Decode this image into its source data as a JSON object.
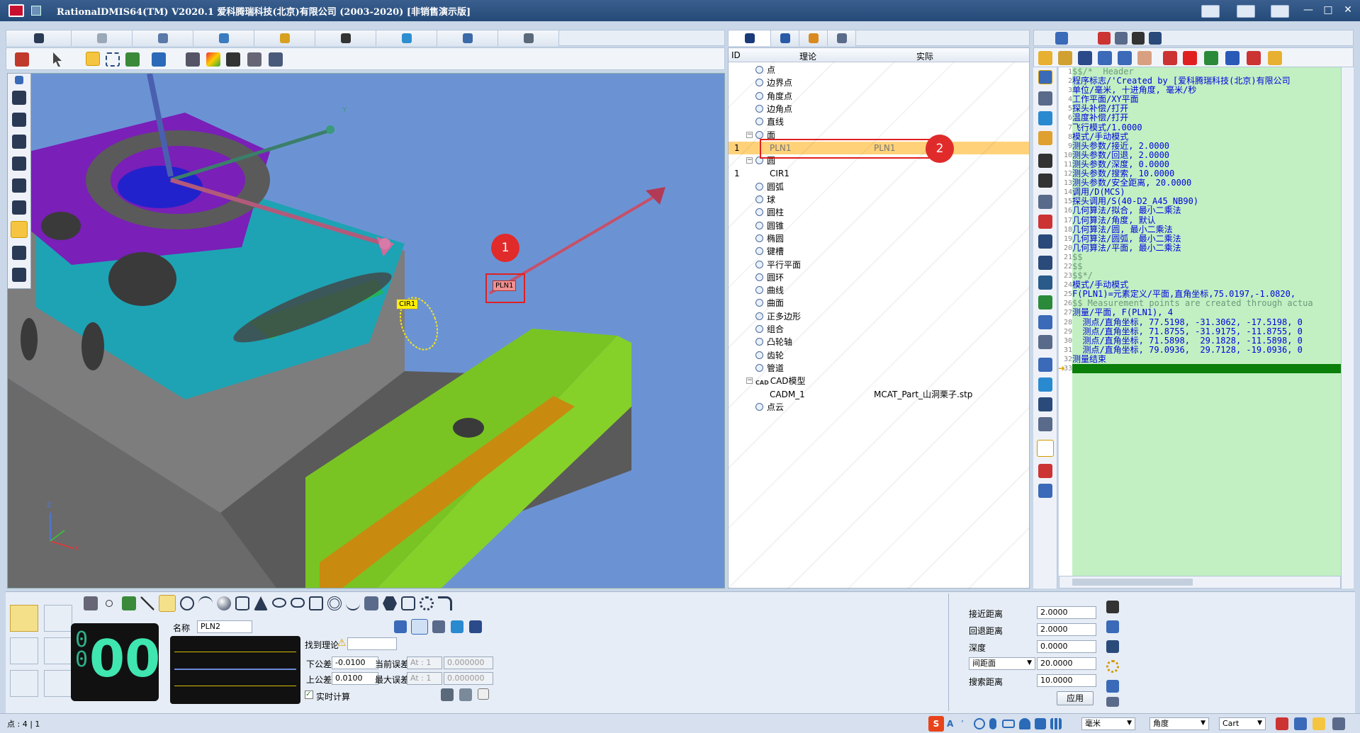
{
  "window": {
    "title": "RationalDMIS64(TM) V2020.1    爱科腾瑞科技(北京)有限公司 (2003-2020) [非销售演示版]"
  },
  "tree": {
    "columns": {
      "id": "ID",
      "theory": "理论",
      "actual": "实际"
    },
    "items": [
      {
        "label": "点"
      },
      {
        "label": "边界点"
      },
      {
        "label": "角度点"
      },
      {
        "label": "边角点"
      },
      {
        "label": "直线"
      },
      {
        "label": "面"
      },
      {
        "label": "PLN1",
        "id": "1",
        "actual": "PLN1"
      },
      {
        "label": "圆"
      },
      {
        "label": "CIR1",
        "id": "1"
      },
      {
        "label": "圆弧"
      },
      {
        "label": "球"
      },
      {
        "label": "圆柱"
      },
      {
        "label": "圆锥"
      },
      {
        "label": "椭圆"
      },
      {
        "label": "键槽"
      },
      {
        "label": "平行平面"
      },
      {
        "label": "圆环"
      },
      {
        "label": "曲线"
      },
      {
        "label": "曲面"
      },
      {
        "label": "正多边形"
      },
      {
        "label": "组合"
      },
      {
        "label": "凸轮轴"
      },
      {
        "label": "齿轮"
      },
      {
        "label": "管道"
      },
      {
        "label": "CAD模型",
        "prefix": "CAD"
      },
      {
        "label": "CADM_1",
        "actual": "MCAT_Part_山洞栗子.stp"
      },
      {
        "label": "点云"
      }
    ]
  },
  "viewport": {
    "labels": {
      "pln": "PLN1",
      "cir": "CIR1"
    },
    "markers": {
      "one": "1",
      "two": "2"
    },
    "axis": {
      "x": "X",
      "y": "Y",
      "z": "Z"
    }
  },
  "editor": {
    "lines": [
      {
        "n": "1",
        "t": "$$/*  Header",
        "c": "g"
      },
      {
        "n": "2",
        "t": "程序标志/'Created by [爱科腾瑞科技(北京)有限公司",
        "c": "b"
      },
      {
        "n": "3",
        "t": "单位/毫米, 十进角度, 毫米/秒",
        "c": "b"
      },
      {
        "n": "4",
        "t": "工作平面/XY平面",
        "c": "b"
      },
      {
        "n": "5",
        "t": "探头补偿/打开",
        "c": "b"
      },
      {
        "n": "6",
        "t": "温度补偿/打开",
        "c": "b"
      },
      {
        "n": "7",
        "t": "飞行模式/1.0000",
        "c": "b"
      },
      {
        "n": "8",
        "t": "模式/手动模式",
        "c": "b"
      },
      {
        "n": "9",
        "t": "测头参数/接近, 2.0000",
        "c": "b"
      },
      {
        "n": "10",
        "t": "测头参数/回退, 2.0000",
        "c": "b"
      },
      {
        "n": "11",
        "t": "测头参数/深度, 0.0000",
        "c": "b"
      },
      {
        "n": "12",
        "t": "测头参数/搜索, 10.0000",
        "c": "b"
      },
      {
        "n": "13",
        "t": "测头参数/安全距离, 20.0000",
        "c": "b"
      },
      {
        "n": "14",
        "t": "调用/D(MCS)",
        "c": "b"
      },
      {
        "n": "15",
        "t": "探头调用/S(40-D2_A45_NB90)",
        "c": "b"
      },
      {
        "n": "16",
        "t": "几何算法/拟合, 最小二乘法",
        "c": "b"
      },
      {
        "n": "17",
        "t": "几何算法/角度, 默认",
        "c": "b"
      },
      {
        "n": "18",
        "t": "几何算法/圆, 最小二乘法",
        "c": "b"
      },
      {
        "n": "19",
        "t": "几何算法/圆弧, 最小二乘法",
        "c": "b"
      },
      {
        "n": "20",
        "t": "几何算法/平面, 最小二乘法",
        "c": "b"
      },
      {
        "n": "21",
        "t": "$$",
        "c": "g"
      },
      {
        "n": "22",
        "t": "$$",
        "c": "g"
      },
      {
        "n": "23",
        "t": "$$*/",
        "c": "g"
      },
      {
        "n": "24",
        "t": "模式/手动模式",
        "c": "b"
      },
      {
        "n": "25",
        "t": "F(PLN1)=元素定义/平面,直角坐标,75.0197,-1.0820,",
        "c": "b"
      },
      {
        "n": "26",
        "t": "$$ Measurement points are created through actua",
        "c": "g"
      },
      {
        "n": "27",
        "t": "测量/平面, F(PLN1), 4",
        "c": "b"
      },
      {
        "n": "28",
        "t": "  测点/直角坐标, 77.5198, -31.3062, -17.5198, 0",
        "c": "b"
      },
      {
        "n": "29",
        "t": "  测点/直角坐标, 71.8755, -31.9175, -11.8755, 0",
        "c": "b"
      },
      {
        "n": "30",
        "t": "  测点/直角坐标, 71.5898,  29.1828, -11.5898, 0",
        "c": "b"
      },
      {
        "n": "31",
        "t": "  测点/直角坐标, 79.0936,  29.7128, -19.0936, 0",
        "c": "b"
      },
      {
        "n": "32",
        "t": "测量结束",
        "c": "b"
      },
      {
        "n": "33",
        "t": "",
        "c": "b"
      }
    ]
  },
  "bottom": {
    "counter": "00",
    "name_label": "名称",
    "name_value": "PLN2",
    "find_theory": "找到理论",
    "lower_tol_label": "下公差",
    "lower_tol": "-0.0100",
    "upper_tol_label": "上公差",
    "upper_tol": "0.0100",
    "cur_err_label": "当前误差",
    "max_err_label": "最大误差",
    "at_cur": "At : 1",
    "at_max": "At : 1",
    "cur_err": "0.000000",
    "max_err": "0.000000",
    "realtime": "实时计算"
  },
  "params": {
    "approach_label": "接近距离",
    "approach": "2.0000",
    "retract_label": "回退距离",
    "retract": "2.0000",
    "depth_label": "深度",
    "depth": "0.0000",
    "clearance_select": "间距面",
    "clearance": "20.0000",
    "search_label": "搜索距离",
    "search": "10.0000",
    "apply": "应用"
  },
  "status": {
    "left": "点 : 4 | 1",
    "unit": "毫米",
    "angle": "角度",
    "coord": "Cart"
  },
  "colors": {
    "accent": "#3a78d2",
    "highlight": "#ffd27a",
    "editor_bg": "#c2f0c2",
    "current_line": "#0a7f0a",
    "marker": "#e12b2b"
  }
}
